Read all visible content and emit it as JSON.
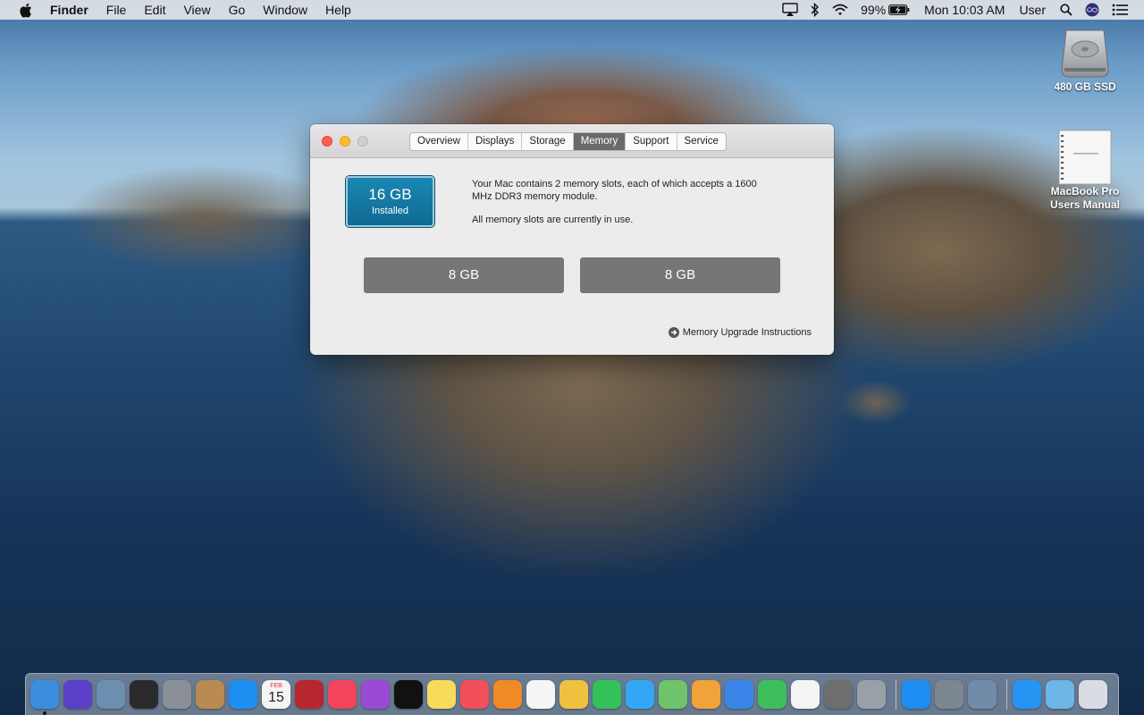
{
  "menubar": {
    "app": "Finder",
    "items": [
      "File",
      "Edit",
      "View",
      "Go",
      "Window",
      "Help"
    ],
    "battery": "99%",
    "clock": "Mon 10:03 AM",
    "user": "User"
  },
  "desktop": {
    "icons": [
      {
        "label": "480 GB SSD"
      },
      {
        "label": "MacBook Pro Users Manual"
      }
    ]
  },
  "window": {
    "tabs": [
      {
        "label": "Overview",
        "active": false
      },
      {
        "label": "Displays",
        "active": false
      },
      {
        "label": "Storage",
        "active": false
      },
      {
        "label": "Memory",
        "active": true
      },
      {
        "label": "Support",
        "active": false
      },
      {
        "label": "Service",
        "active": false
      }
    ],
    "installed": {
      "size": "16 GB",
      "label": "Installed"
    },
    "description": {
      "line1": "Your Mac contains 2 memory slots, each of which accepts a 1600 MHz DDR3 memory module.",
      "line2": "All memory slots are currently in use."
    },
    "slots": [
      "8 GB",
      "8 GB"
    ],
    "upgrade_link": "Memory Upgrade Instructions"
  },
  "dock": {
    "items": [
      {
        "name": "finder-icon",
        "color": "#3b8de0",
        "running": true
      },
      {
        "name": "siri-icon",
        "color": "#5a3fc7"
      },
      {
        "name": "preview-icon",
        "color": "#6c8fb0"
      },
      {
        "name": "activity-monitor-icon",
        "color": "#2b2b2b"
      },
      {
        "name": "launchpad-icon",
        "color": "#8a8f98"
      },
      {
        "name": "contacts-icon",
        "color": "#b98a52"
      },
      {
        "name": "safari-icon",
        "color": "#1d8ff0"
      },
      {
        "name": "calendar-icon",
        "color": "#f4f4f4"
      },
      {
        "name": "photo-booth-icon",
        "color": "#b7282e"
      },
      {
        "name": "music-icon",
        "color": "#f2445c"
      },
      {
        "name": "podcasts-icon",
        "color": "#9b4ad6"
      },
      {
        "name": "apple-tv-icon",
        "color": "#111111"
      },
      {
        "name": "notes-icon",
        "color": "#f7dc5c"
      },
      {
        "name": "news-icon",
        "color": "#f24f5b"
      },
      {
        "name": "books-icon",
        "color": "#f08a24"
      },
      {
        "name": "reminders-icon",
        "color": "#f5f5f5"
      },
      {
        "name": "photos-icon",
        "color": "#f0c040"
      },
      {
        "name": "facetime-icon",
        "color": "#33c15a"
      },
      {
        "name": "messages-icon",
        "color": "#33a7f5"
      },
      {
        "name": "maps-icon",
        "color": "#6fc36b"
      },
      {
        "name": "pages-icon",
        "color": "#f2a23a"
      },
      {
        "name": "keynote-icon",
        "color": "#3a86e8"
      },
      {
        "name": "numbers-icon",
        "color": "#3cbf5b"
      },
      {
        "name": "chrome-icon",
        "color": "#f4f4f4"
      },
      {
        "name": "system-preferences-icon",
        "color": "#6e6e6e"
      },
      {
        "name": "disk-utility-icon",
        "color": "#9aa0a8"
      },
      {
        "name": "app-store-icon",
        "color": "#1e8df2"
      },
      {
        "name": "automator-icon",
        "color": "#7d8791"
      },
      {
        "name": "image-capture-icon",
        "color": "#708ca8"
      },
      {
        "name": "app-store-folder-icon",
        "color": "#2793f3"
      },
      {
        "name": "downloads-folder-icon",
        "color": "#6cb6e8"
      },
      {
        "name": "trash-icon",
        "color": "#d9dde3"
      }
    ],
    "calendar": {
      "month": "FEB",
      "day": "15"
    }
  }
}
